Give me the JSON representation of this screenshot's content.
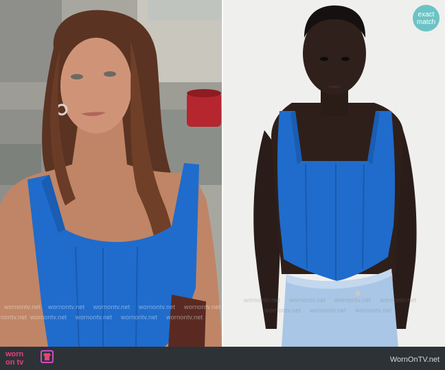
{
  "left_image": {
    "alt": "woman-in-blue-corset-top-tv-scene",
    "watermark": "wornontv.net"
  },
  "right_image": {
    "alt": "model-in-blue-corset-top-product",
    "watermark": "wornontv.net"
  },
  "badge": {
    "line1": "exact",
    "line2": "match"
  },
  "footer": {
    "logo_line1": "worn",
    "logo_line2": "on tv",
    "site": "WornOnTV.net"
  },
  "colors": {
    "top_blue": "#1f6ccc",
    "badge": "#6cc3c6",
    "footer_bg": "#2d3237",
    "logo_pink": "#e8417d"
  }
}
